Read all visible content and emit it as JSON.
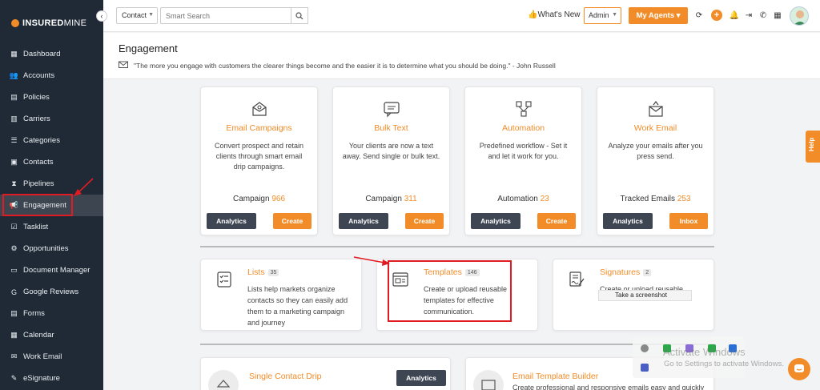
{
  "brand": {
    "name_bold": "INSURED",
    "name_thin": "MINE"
  },
  "sidebar": {
    "items": [
      {
        "label": "Dashboard",
        "icon": "dashboard-icon"
      },
      {
        "label": "Accounts",
        "icon": "accounts-icon"
      },
      {
        "label": "Policies",
        "icon": "policies-icon"
      },
      {
        "label": "Carriers",
        "icon": "carriers-icon"
      },
      {
        "label": "Categories",
        "icon": "categories-icon"
      },
      {
        "label": "Contacts",
        "icon": "contacts-icon"
      },
      {
        "label": "Pipelines",
        "icon": "pipelines-icon"
      },
      {
        "label": "Engagement",
        "icon": "megaphone-icon",
        "active": true
      },
      {
        "label": "Tasklist",
        "icon": "tasklist-icon"
      },
      {
        "label": "Opportunities",
        "icon": "opportunities-icon"
      },
      {
        "label": "Document Manager",
        "icon": "folder-icon"
      },
      {
        "label": "Google Reviews",
        "icon": "google-icon"
      },
      {
        "label": "Forms",
        "icon": "forms-icon"
      },
      {
        "label": "Calendar",
        "icon": "calendar-icon"
      },
      {
        "label": "Work Email",
        "icon": "mail-icon"
      },
      {
        "label": "eSignature",
        "icon": "signature-icon"
      }
    ]
  },
  "topbar": {
    "search_scope": "Contact",
    "search_placeholder": "Smart Search",
    "whats_new": "What's New",
    "role": "Admin",
    "agents_button": "My Agents"
  },
  "header": {
    "title": "Engagement",
    "quote": "\"The more you engage with customers the clearer things become and the easier it is to determine what you should be doing.\" - John Russell"
  },
  "cards": [
    {
      "title": "Email Campaigns",
      "desc": "Convert prospect and retain clients through smart email drip campaigns.",
      "count_label": "Campaign",
      "count": "966",
      "btn1": "Analytics",
      "btn2": "Create"
    },
    {
      "title": "Bulk Text",
      "desc": "Your clients are now a text away. Send single or bulk text.",
      "count_label": "Campaign",
      "count": "311",
      "btn1": "Analytics",
      "btn2": "Create"
    },
    {
      "title": "Automation",
      "desc": "Predefined workflow - Set it and let it work for you.",
      "count_label": "Automation",
      "count": "23",
      "btn1": "Analytics",
      "btn2": "Create"
    },
    {
      "title": "Work Email",
      "desc": "Analyze your emails after you press send.",
      "count_label": "Tracked Emails",
      "count": "253",
      "btn1": "Analytics",
      "btn2": "Inbox"
    }
  ],
  "cards2": [
    {
      "title": "Lists",
      "badge": "35",
      "desc": "Lists help markets organize contacts so they can easily add them to a marketing campaign and journey"
    },
    {
      "title": "Templates",
      "badge": "146",
      "desc": "Create or upload reusable templates for effective communication."
    },
    {
      "title": "Signatures",
      "badge": "2",
      "desc": "Create or upload reusable"
    }
  ],
  "cards3": [
    {
      "title": "Single Contact Drip",
      "btn": "Analytics"
    },
    {
      "title": "Email Template Builder",
      "desc": "Create professional and responsive emails easy and quickly"
    }
  ],
  "tooltip": "Take a screenshot",
  "help_tab": "Help",
  "watermark": {
    "line1": "Activate Windows",
    "line2": "Go to Settings to activate Windows."
  },
  "colors": {
    "accent": "#f28c28",
    "sidebar": "#1f2a36",
    "dark_button": "#3e4553",
    "highlight": "#e11b22"
  }
}
